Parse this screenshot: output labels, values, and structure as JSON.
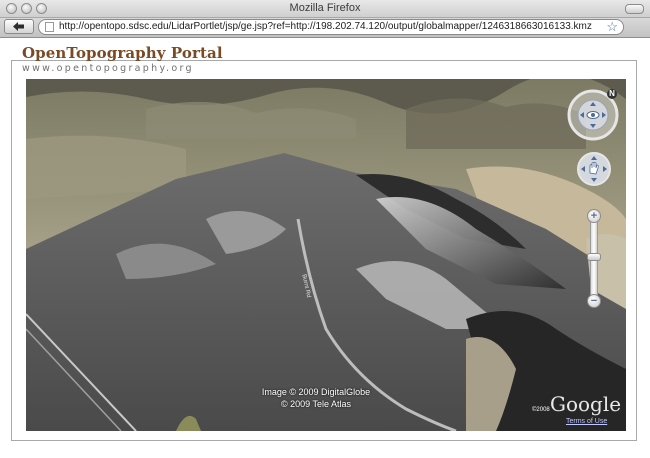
{
  "window": {
    "title": "Mozilla Firefox"
  },
  "toolbar": {
    "url": "http://opentopo.sdsc.edu/LidarPortlet/jsp/ge.jsp?ref=http://198.202.74.120/output/globalmapper/1246318663016133.kmz"
  },
  "header": {
    "brand": "OpenTopography Portal",
    "tagline": "www.opentopography.org"
  },
  "map": {
    "attribution_line1": "Image © 2009 DigitalGlobe",
    "attribution_line2": "© 2009 Tele Atlas",
    "copyright_small": "©2008",
    "logo": "Google",
    "terms": "Terms of Use",
    "road_label": "Burnt Rd",
    "zoom_in_label": "+",
    "zoom_out_label": "−",
    "compass_label": "N"
  },
  "colors": {
    "brand": "#7a4a24",
    "control_accent": "#5a6e8c"
  },
  "icons": {
    "back": "back-arrow-icon",
    "page": "page-icon",
    "bookmark": "star-icon",
    "look": "eye-icon",
    "move": "hand-icon"
  }
}
